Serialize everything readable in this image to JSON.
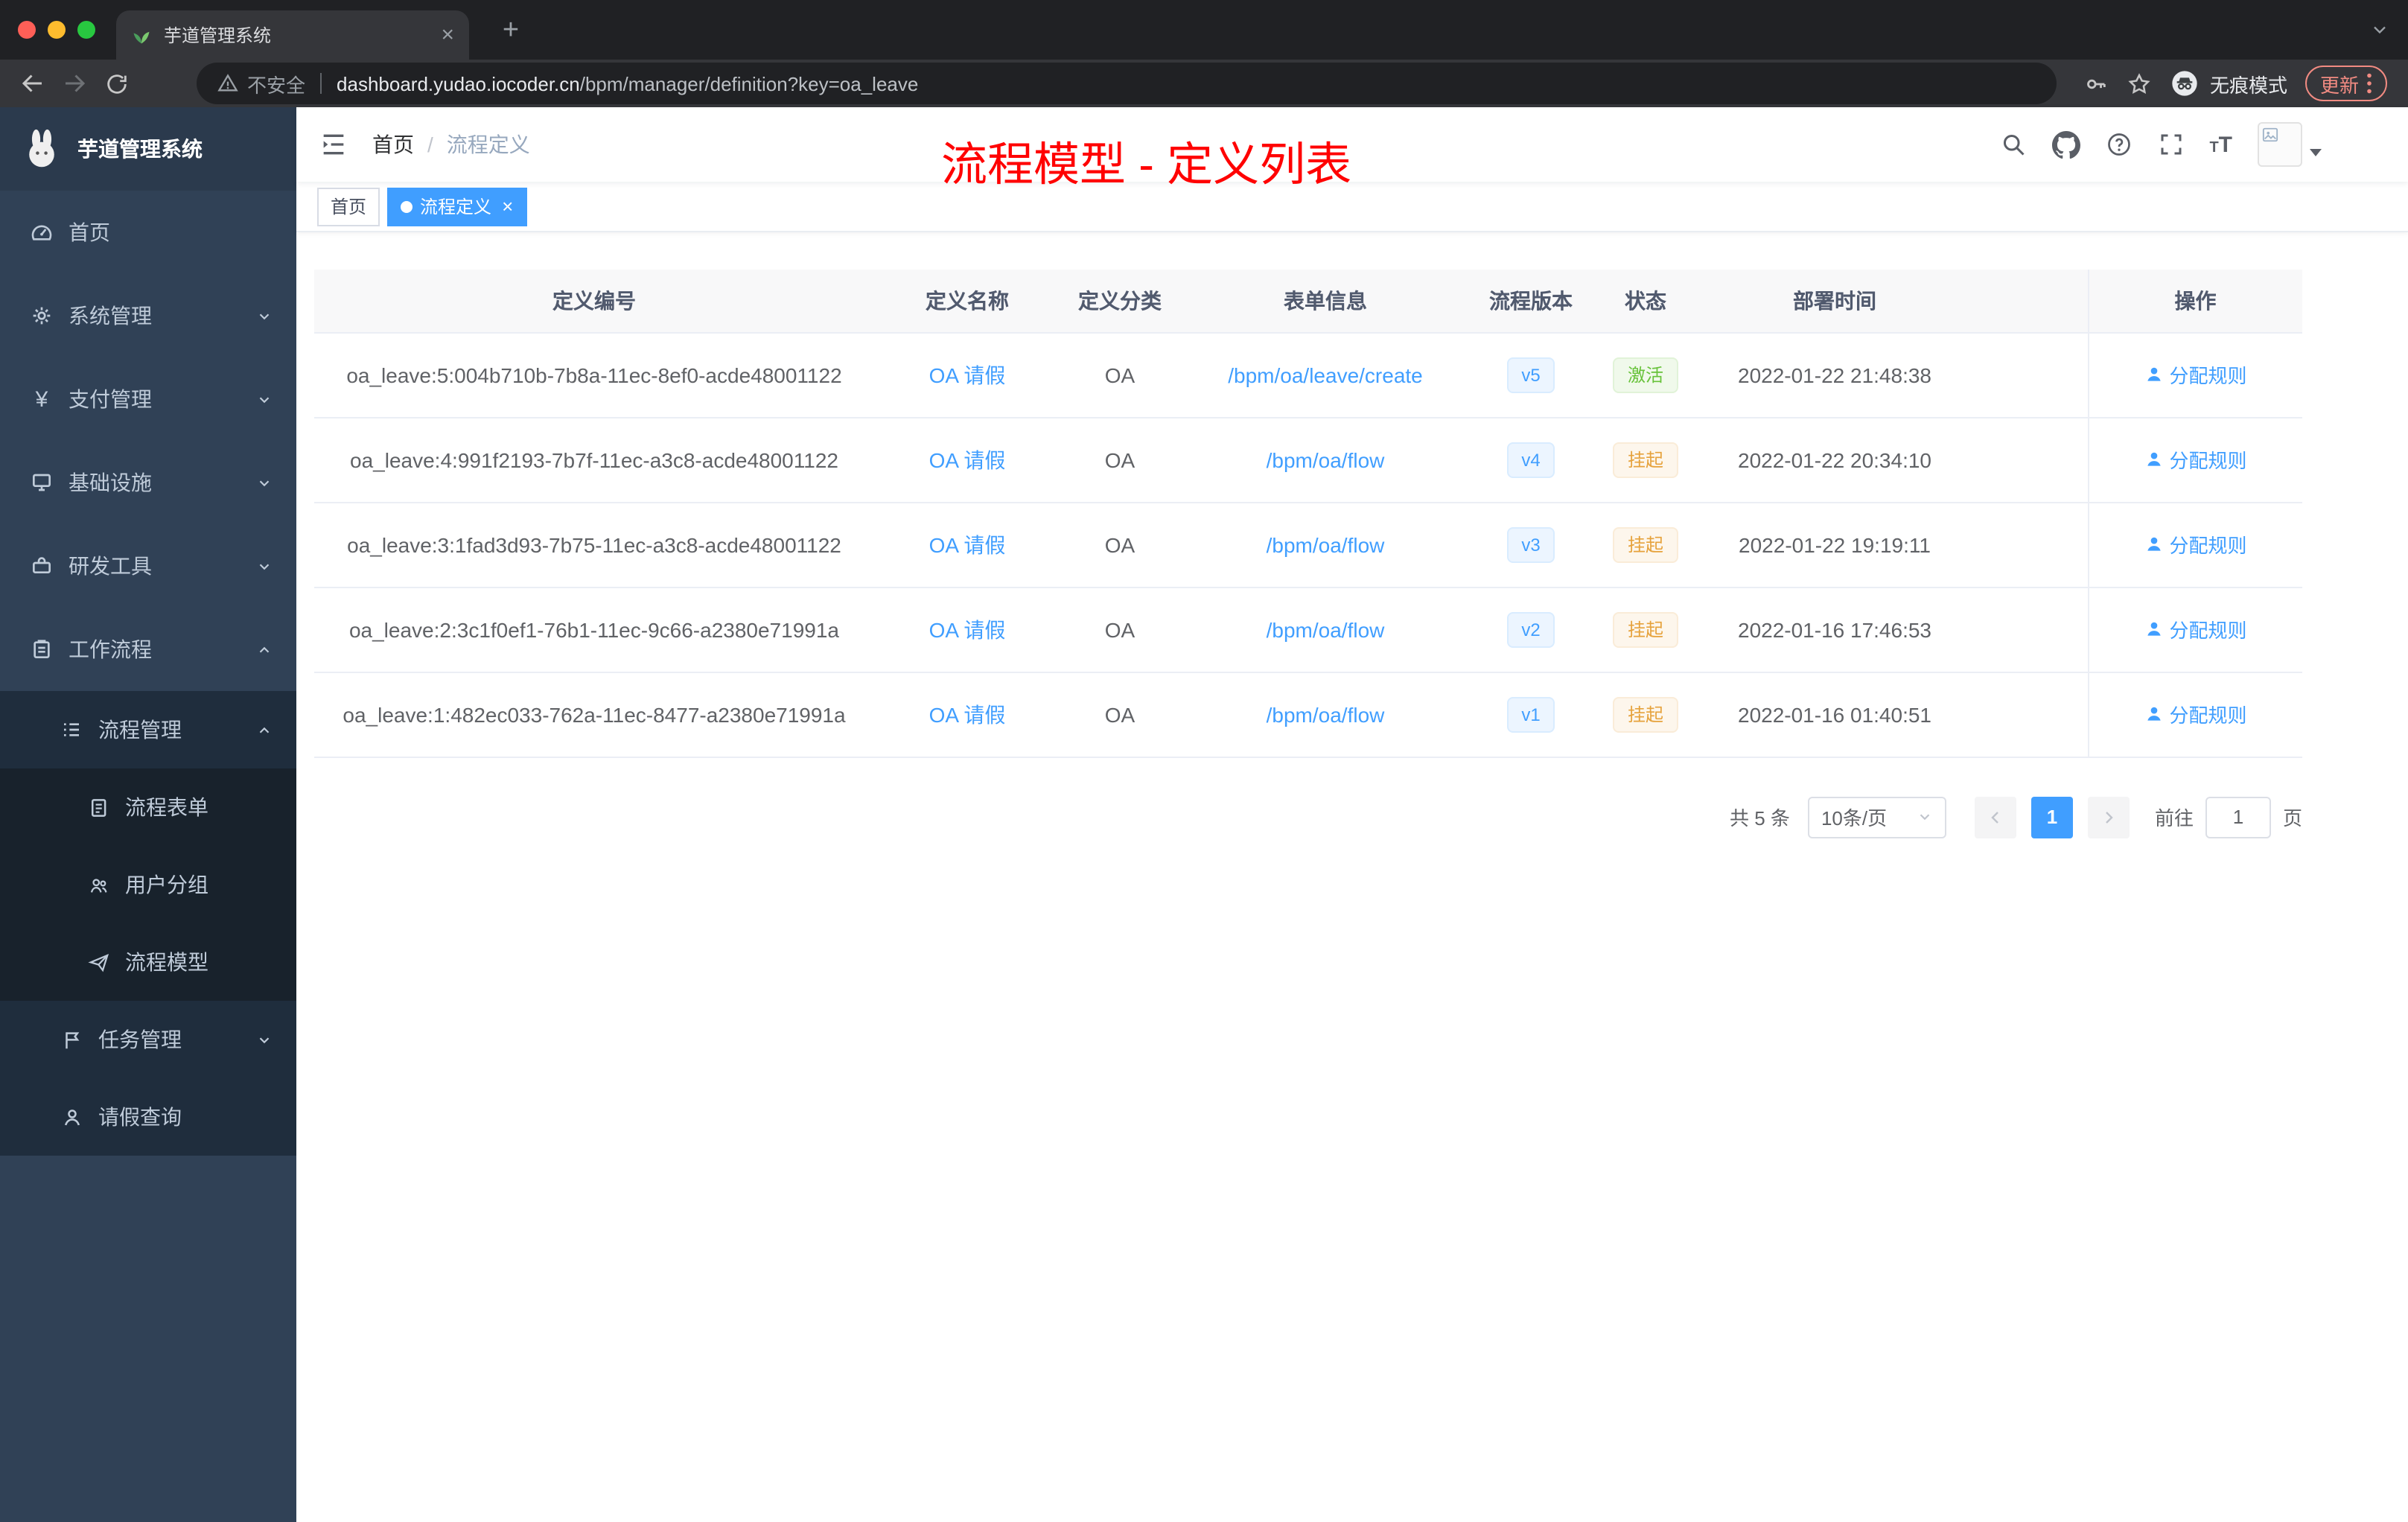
{
  "browser": {
    "tab": {
      "title": "芋道管理系统",
      "close_glyph": "×",
      "new_tab_glyph": "+"
    },
    "address": {
      "security_label": "不安全",
      "domain": "dashboard.yudao.iocoder.cn",
      "path": "/bpm/manager/definition?key=oa_leave",
      "incognito_label": "无痕模式",
      "update_label": "更新"
    }
  },
  "sidebar": {
    "logo_title": "芋道管理系统",
    "menu": {
      "home": "首页",
      "system": "系统管理",
      "payment": "支付管理",
      "infra": "基础设施",
      "devtools": "研发工具",
      "workflow": "工作流程",
      "process_mgmt": "流程管理",
      "process_form": "流程表单",
      "user_group": "用户分组",
      "process_model": "流程模型",
      "task_mgmt": "任务管理",
      "leave_query": "请假查询"
    }
  },
  "header": {
    "breadcrumb_home": "首页",
    "breadcrumb_separator": "/",
    "breadcrumb_current": "流程定义",
    "annotation": "流程模型 - 定义列表"
  },
  "tags": {
    "home": "首页",
    "current": "流程定义",
    "close_glyph": "×"
  },
  "table": {
    "columns": {
      "id": "定义编号",
      "name": "定义名称",
      "category": "定义分类",
      "form": "表单信息",
      "version": "流程版本",
      "status": "状态",
      "deploy_time": "部署时间",
      "action": "操作"
    },
    "rows": [
      {
        "id": "oa_leave:5:004b710b-7b8a-11ec-8ef0-acde48001122",
        "name": "OA 请假",
        "category": "OA",
        "form": "/bpm/oa/leave/create",
        "version": "v5",
        "status": "激活",
        "deploy_time": "2022-01-22 21:48:38",
        "action": "分配规则"
      },
      {
        "id": "oa_leave:4:991f2193-7b7f-11ec-a3c8-acde48001122",
        "name": "OA 请假",
        "category": "OA",
        "form": "/bpm/oa/flow",
        "version": "v4",
        "status": "挂起",
        "deploy_time": "2022-01-22 20:34:10",
        "action": "分配规则"
      },
      {
        "id": "oa_leave:3:1fad3d93-7b75-11ec-a3c8-acde48001122",
        "name": "OA 请假",
        "category": "OA",
        "form": "/bpm/oa/flow",
        "version": "v3",
        "status": "挂起",
        "deploy_time": "2022-01-22 19:19:11",
        "action": "分配规则"
      },
      {
        "id": "oa_leave:2:3c1f0ef1-76b1-11ec-9c66-a2380e71991a",
        "name": "OA 请假",
        "category": "OA",
        "form": "/bpm/oa/flow",
        "version": "v2",
        "status": "挂起",
        "deploy_time": "2022-01-16 17:46:53",
        "action": "分配规则"
      },
      {
        "id": "oa_leave:1:482ec033-762a-11ec-8477-a2380e71991a",
        "name": "OA 请假",
        "category": "OA",
        "form": "/bpm/oa/flow",
        "version": "v1",
        "status": "挂起",
        "deploy_time": "2022-01-16 01:40:51",
        "action": "分配规则"
      }
    ]
  },
  "pagination": {
    "total": "共 5 条",
    "page_size": "10条/页",
    "current_page": "1",
    "goto_label": "前往",
    "goto_value": "1",
    "unit_label": "页"
  },
  "colors": {
    "accent_blue": "#409eff",
    "success_green": "#67c23a",
    "warning_orange": "#e6a23c",
    "annotation_red": "#ff0000",
    "sidebar_bg": "#304156"
  }
}
